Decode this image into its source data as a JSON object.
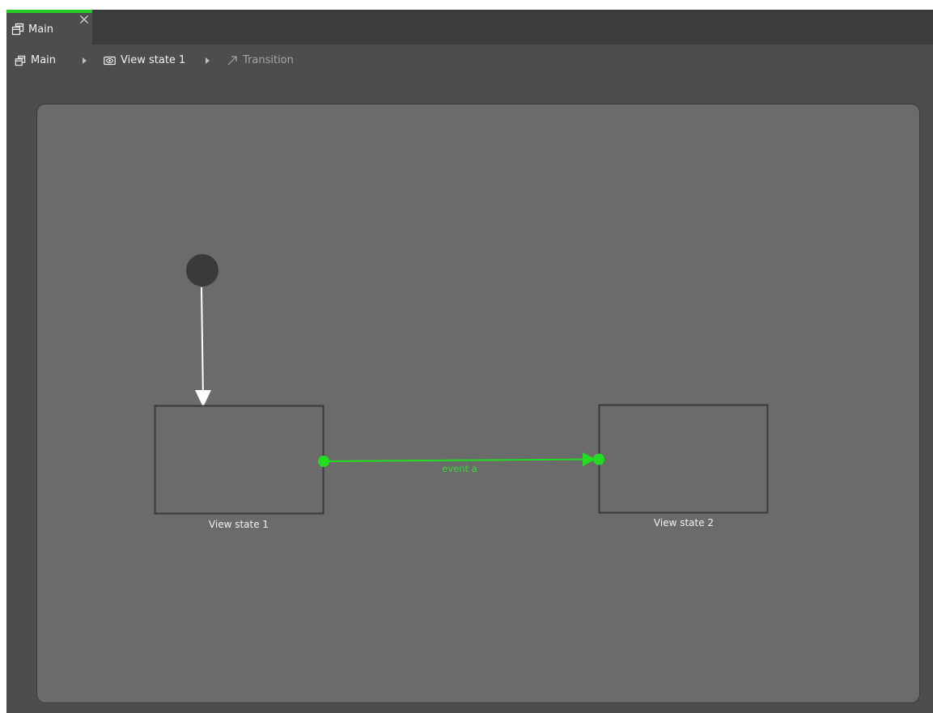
{
  "tabbar": {
    "tab": {
      "label": "Main",
      "icon": "window-icon",
      "close_icon": "close-icon",
      "active_color": "#22cc22"
    }
  },
  "breadcrumb": {
    "items": [
      {
        "label": "Main",
        "icon": "window-icon"
      },
      {
        "label": "View state 1",
        "icon": "eye-icon"
      },
      {
        "label": "Transition",
        "icon": "transition-arrow-icon"
      }
    ]
  },
  "diagram": {
    "initial_state": {
      "color": "#3a3a3a"
    },
    "states": [
      {
        "label": "View state 1"
      },
      {
        "label": "View state 2"
      }
    ],
    "transitions": [
      {
        "from": "initial",
        "to": "View state 1",
        "color": "#ffffff"
      },
      {
        "from": "View state 1",
        "to": "View state 2",
        "event": "event a",
        "color": "#22dd22",
        "selected": true
      }
    ]
  }
}
